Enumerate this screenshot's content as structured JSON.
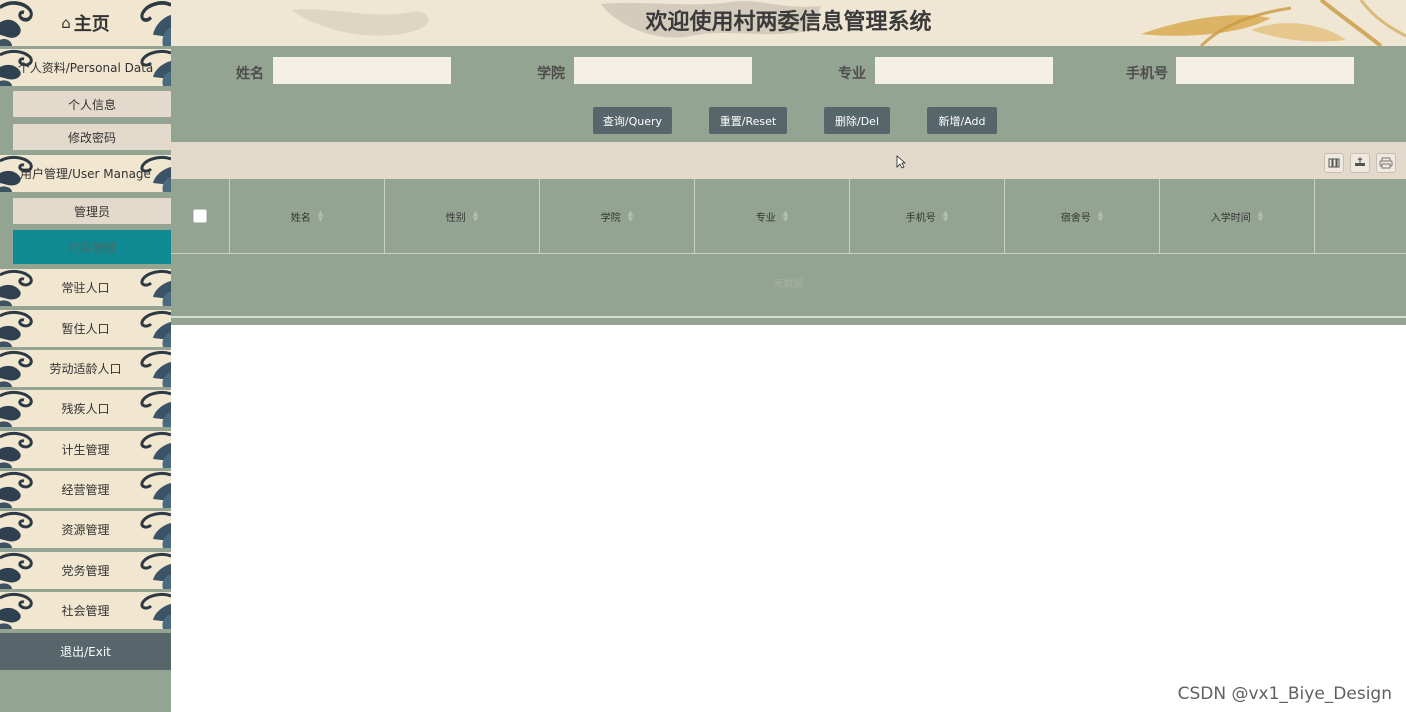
{
  "header": {
    "title": "欢迎使用村两委信息管理系统"
  },
  "sidebar": {
    "home": {
      "icon": "home-icon",
      "glyph": "⌂",
      "label": "主页"
    },
    "personal": {
      "label": "个人资料/Personal Data",
      "items": [
        "个人信息",
        "修改密码"
      ]
    },
    "user_manage": {
      "label": "用户管理/User Manage",
      "items": [
        "管理员",
        "村民管理"
      ]
    },
    "menu": [
      "常驻人口",
      "暂住人口",
      "劳动适龄人口",
      "残疾人口",
      "计生管理",
      "经营管理",
      "资源管理",
      "党务管理",
      "社会管理"
    ],
    "exit": "退出/Exit"
  },
  "search": {
    "fields": [
      {
        "label": "姓名",
        "value": ""
      },
      {
        "label": "学院",
        "value": ""
      },
      {
        "label": "专业",
        "value": ""
      },
      {
        "label": "手机号",
        "value": ""
      }
    ],
    "buttons": [
      "查询/Query",
      "重置/Reset",
      "删除/Del",
      "新增/Add"
    ]
  },
  "toolbar": {
    "icons": [
      "columns-icon",
      "export-icon",
      "print-icon"
    ]
  },
  "table": {
    "columns": [
      "姓名",
      "性别",
      "学院",
      "专业",
      "手机号",
      "宿舍号",
      "入学时间"
    ],
    "empty_text": "无数据"
  },
  "watermark": "CSDN @vx1_Biye_Design",
  "colors": {
    "sage": "#94a492",
    "cream": "#f1e6cf",
    "active": "#0f8a92",
    "button": "#56666a"
  }
}
